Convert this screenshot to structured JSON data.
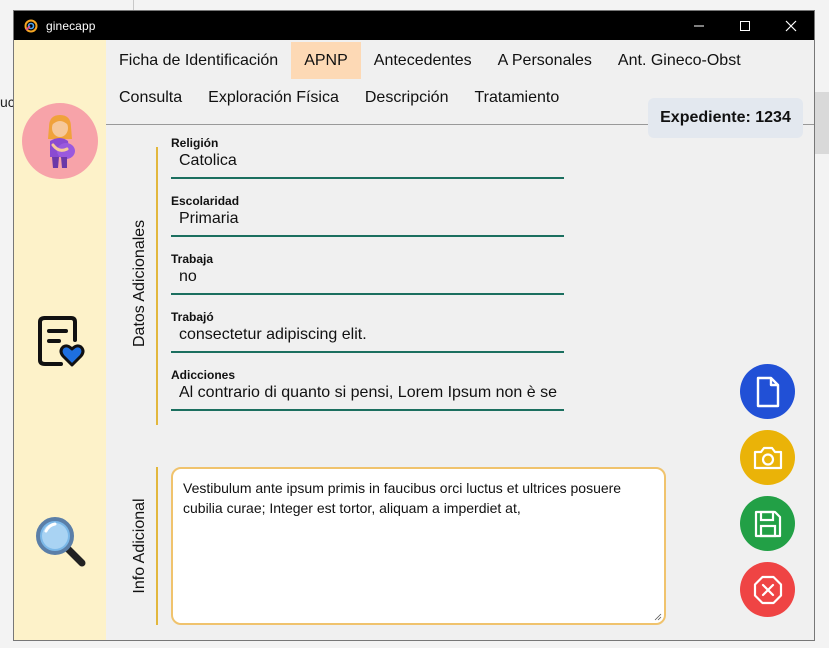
{
  "window": {
    "title": "ginecapp"
  },
  "background": {
    "left_fragment": "uc"
  },
  "tabs_row1": [
    {
      "label": "Ficha de Identificación",
      "active": false
    },
    {
      "label": "APNP",
      "active": true
    },
    {
      "label": "Antecedentes",
      "active": false
    },
    {
      "label": "A Personales",
      "active": false
    },
    {
      "label": "Ant. Gineco-Obst",
      "active": false
    }
  ],
  "tabs_row2": [
    {
      "label": "Consulta",
      "active": false
    },
    {
      "label": "Exploración Física",
      "active": false
    },
    {
      "label": "Descripción",
      "active": false
    },
    {
      "label": "Tratamiento",
      "active": false
    }
  ],
  "expediente": {
    "label": "Expediente: 1234"
  },
  "groups": {
    "datos_adicionales": "Datos Adicionales",
    "info_adicional": "Info Adicional"
  },
  "fields": {
    "religion": {
      "label": "Religión",
      "value": "Catolica"
    },
    "escolaridad": {
      "label": "Escolaridad",
      "value": "Primaria"
    },
    "trabaja": {
      "label": "Trabaja",
      "value": "no"
    },
    "trabajo": {
      "label": "Trabajó",
      "value": "consectetur adipiscing elit."
    },
    "adicciones": {
      "label": "Adicciones",
      "value": "Al contrario di quanto si pensi, Lorem Ipsum non è se"
    }
  },
  "info_adicional": {
    "text": "Vestibulum ante ipsum primis in faucibus orci luctus et ultrices posuere cubilia curae; Integer est tortor, aliquam a imperdiet at,"
  },
  "icons": {
    "avatar": "pregnant-woman-icon",
    "record": "medical-record-heart-icon",
    "search": "magnifier-icon",
    "new": "document-icon",
    "camera": "camera-icon",
    "save": "floppy-disk-icon",
    "cancel": "stop-x-icon"
  },
  "colors": {
    "sidebar_bg": "#fdf2c9",
    "avatar_bg": "#f7a3a9",
    "active_tab": "#fdd9b5",
    "field_underline": "#1b6f5f",
    "group_bar": "#e2b73d",
    "textarea_border": "#f0c36d",
    "btn_doc": "#2150d6",
    "btn_camera": "#eab308",
    "btn_save": "#22a046",
    "btn_cancel": "#ef4444"
  }
}
